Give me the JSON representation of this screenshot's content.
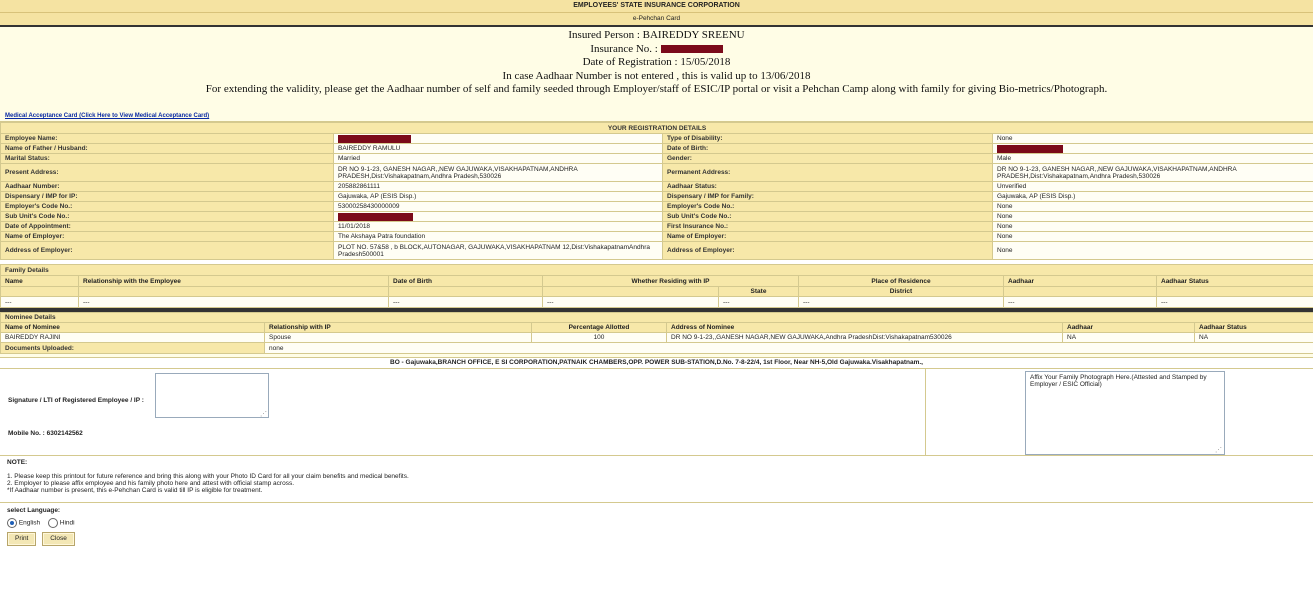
{
  "header": {
    "title": "EMPLOYEES' STATE INSURANCE CORPORATION",
    "subtitle": "e-Pehchan Card"
  },
  "info": {
    "insured_person": "Insured Person : BAIREDDY SREENU",
    "insurance_no_label": "Insurance No. :",
    "date_of_registration": "Date of Registration : 15/05/2018",
    "aadhaar_note": "In case Aadhaar Number is not entered , this is valid up to 13/06/2018",
    "extend_note": "For extending the validity, please get the Aadhaar number of self and family seeded through Employer/staff of ESIC/IP portal or visit a Pehchan Camp along with family for giving Bio-metrics/Photograph."
  },
  "medical_link": "Medical Acceptance Card (Click Here to View Medical Acceptance Card)",
  "registration": {
    "title": "YOUR REGISTRATION DETAILS",
    "rows": [
      {
        "l1": "Employee Name:",
        "v1": "BAIREDDY SREENU",
        "l2": "Type of Disability:",
        "v2": "None"
      },
      {
        "l1": "Name of Father / Husband:",
        "v1": "BAIREDDY RAMULU",
        "l2": "Date of Birth:",
        "v2": ""
      },
      {
        "l1": "Marital Status:",
        "v1": "Married",
        "l2": "Gender:",
        "v2": "Male"
      },
      {
        "l1": "Present Address:",
        "v1": "DR NO 9-1-23, GANESH NAGAR,,NEW GAJUWAKA,VISAKHAPATNAM,ANDHRA PRADESH,Dist:Vishakapatnam,Andhra Pradesh,530026",
        "l2": "Permanent Address:",
        "v2": "DR NO 9-1-23, GANESH NAGAR,,NEW GAJUWAKA,VISAKHAPATNAM,ANDHRA PRADESH,Dist:Vishakapatnam,Andhra Pradesh,530026"
      },
      {
        "l1": "Aadhaar Number:",
        "v1": "205882861111",
        "l2": "Aadhaar Status:",
        "v2": "Unverified"
      },
      {
        "l1": "Dispensary / IMP for IP:",
        "v1": "Gajuwaka, AP (ESIS Disp.)",
        "l2": "Dispensary / IMP for Family:",
        "v2": "Gajuwaka, AP (ESIS Disp.)"
      },
      {
        "l1": "Employer's Code No.:",
        "v1": "53000258430000009",
        "l2": "Employer's Code No.:",
        "v2": "None"
      },
      {
        "l1": "Sub Unit's Code No.:",
        "v1": "",
        "l2": "Sub Unit's Code No.:",
        "v2": "None"
      },
      {
        "l1": "Date of Appointment:",
        "v1": "11/01/2018",
        "l2": "First Insurance No.:",
        "v2": "None"
      },
      {
        "l1": "Name of Employer:",
        "v1": "The Akshaya Patra foundation",
        "l2": "Name of Employer:",
        "v2": "None"
      },
      {
        "l1": "Address of Employer:",
        "v1": "PLOT NO. 57&58 , b BLOCK,AUTONAGAR, GAJUWAKA,VISAKHAPATNAM 12,Dist:VishakapatnamAndhra Pradesh500001",
        "l2": "Address of Employer:",
        "v2": "None"
      }
    ]
  },
  "family": {
    "title": "Family Details",
    "headers": [
      "Name",
      "Relationship with the Employee",
      "Date of Birth",
      "Whether Residing with IP",
      "Place of Residence",
      "Aadhaar",
      "Aadhaar Status"
    ],
    "sub_headers": [
      "State",
      "District"
    ],
    "row": [
      "---",
      "---",
      "---",
      "---",
      "---",
      "---",
      "---",
      "---"
    ]
  },
  "nominee": {
    "title": "Nominee Details",
    "headers": [
      "Name of Nominee",
      "Relationship with IP",
      "Percentage Allotted",
      "Address of Nominee",
      "Aadhaar",
      "Aadhaar Status"
    ],
    "row": [
      "BAIREDDY RAJINI",
      "Spouse",
      "100",
      "DR NO 9-1-23,,GANESH NAGAR,NEW GAJUWAKA,Andhra PradeshDist:Vishakapatnam530026",
      "NA",
      "NA"
    ]
  },
  "documents": {
    "label": "Documents Uploaded:",
    "value": "none"
  },
  "branch_office": "BO - Gajuwaka,BRANCH OFFICE, E SI CORPORATION,PATNAIK CHAMBERS,OPP. POWER SUB-STATION,D.No. 7-8-22/4, 1st Floor, Near NH-5,Old Gajuwaka.Visakhapatnam.,",
  "signature_label": "Signature / LTI of Registered Employee / IP :",
  "mobile": "Mobile No. : 6302142562",
  "photo_placeholder": "Affix Your Family Photograph Here.(Attested and Stamped by Employer / ESIC Official)",
  "note": {
    "title": "NOTE:",
    "lines": [
      "1. Please keep this printout for future reference and bring this along with your Photo ID Card for all your claim benefits and medical benefits.",
      "2. Employer to please affix employee and his family photo here and attest with official stamp across.",
      "*If Aadhaar number is present, this e-Pehchan Card is valid till IP is eligible for treatment."
    ]
  },
  "language": {
    "label": "select Language:",
    "english": "English",
    "hindi": "Hindi"
  },
  "buttons": {
    "print": "Print",
    "close": "Close"
  },
  "colors": {
    "header_bg": "#f5e3a2",
    "redaction": "#7b0a1a"
  }
}
